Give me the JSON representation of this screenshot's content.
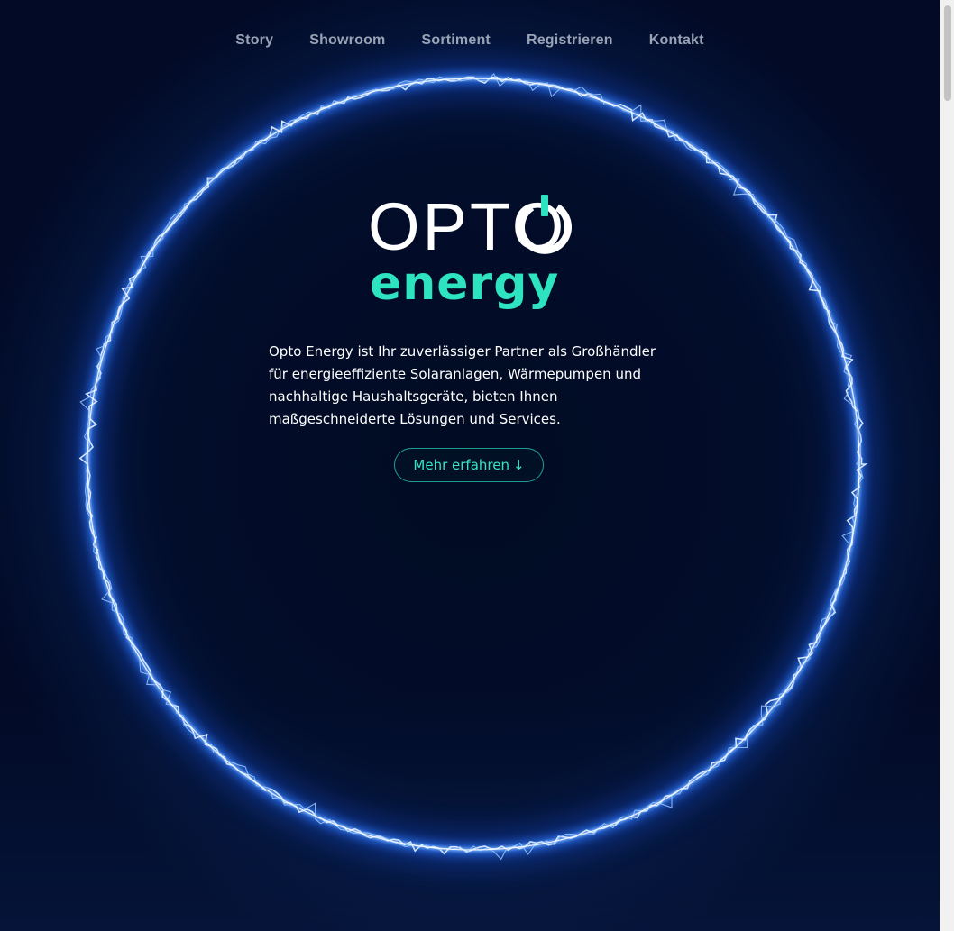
{
  "nav": {
    "items": [
      {
        "label": "Story"
      },
      {
        "label": "Showroom"
      },
      {
        "label": "Sortiment"
      },
      {
        "label": "Registrieren"
      },
      {
        "label": "Kontakt"
      }
    ]
  },
  "hero": {
    "logo": {
      "wordmark_top": "OPTO",
      "wordmark_bottom": "energy",
      "icon": "power-icon"
    },
    "intro_text": "Opto Energy ist Ihr zuverlässiger Partner als Großhändler für energieeffiziente Solaranlagen, Wärmepumpen und nachhaltige Haushaltsgeräte, bieten Ihnen maßgeschneiderte Lösungen und Services.",
    "cta": {
      "label": "Mehr erfahren",
      "icon": "arrow-down-icon",
      "arrow_glyph": "↓"
    }
  },
  "colors": {
    "background": "#020a24",
    "ring_glow": "#2f7bff",
    "accent": "#2de3c0",
    "nav_text": "#9aa3b4",
    "text": "#ffffff"
  }
}
